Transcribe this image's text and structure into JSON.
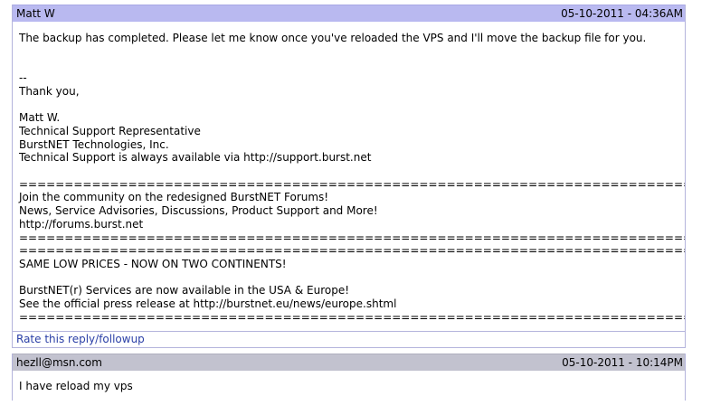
{
  "replies": [
    {
      "author": "Matt W",
      "date": "05-10-2011 - 04:36AM",
      "body": "The backup has completed. Please let me know once you've reloaded the VPS and I'll move the backup file for you.\n\n\n--\nThank you,\n\nMatt W.\nTechnical Support Representative\nBurstNET Technologies, Inc.\nTechnical Support is always available via http://support.burst.net\n\n==========================================================================\nJoin the community on the redesigned BurstNET Forums!\nNews, Service Advisories, Discussions, Product Support and More!\nhttp://forums.burst.net\n==========================================================================\n==================================================================================\nSAME LOW PRICES - NOW ON TWO CONTINENTS!\n\nBurstNET(r) Services are now available in the USA & Europe!\nSee the official press release at http://burstnet.eu/news/europe.shtml\n==================================================================================",
      "footer_link": "Rate this reply/followup"
    },
    {
      "author": "hezll@msn.com",
      "date": "05-10-2011 - 10:14PM",
      "body": "I have reload my vps"
    }
  ]
}
